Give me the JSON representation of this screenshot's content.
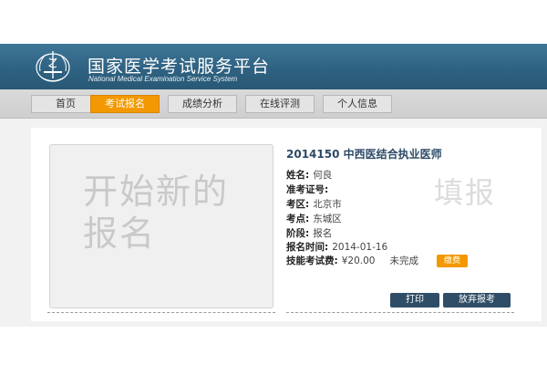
{
  "header": {
    "title": "国家医学考试服务平台",
    "subtitle": "National Medical Examination Service System"
  },
  "nav": {
    "items": [
      {
        "label": "首页"
      },
      {
        "label": "考试报名"
      },
      {
        "label": "成绩分析"
      },
      {
        "label": "在线评测"
      },
      {
        "label": "个人信息"
      }
    ],
    "active_index": 1
  },
  "promo": {
    "text": "开始新的报名"
  },
  "exam": {
    "title": "2014150 中西医结合执业医师",
    "fields": [
      {
        "label": "姓名:",
        "value": "何良"
      },
      {
        "label": "准考证号:",
        "value": ""
      },
      {
        "label": "考区:",
        "value": "北京市"
      },
      {
        "label": "考点:",
        "value": "东城区"
      },
      {
        "label": "阶段:",
        "value": "报名"
      },
      {
        "label": "报名时间:",
        "value": "2014-01-16"
      }
    ],
    "fee": {
      "label": "技能考试费:",
      "value": "¥20.00",
      "status": "未完成",
      "pay_label": "缴费"
    },
    "watermark": "填报"
  },
  "actions": {
    "print_label": "打印",
    "abandon_label": "放弃报考"
  },
  "colors": {
    "header_blue": "#2f6282",
    "accent_orange": "#f39800",
    "button_dark": "#2f4d67"
  }
}
